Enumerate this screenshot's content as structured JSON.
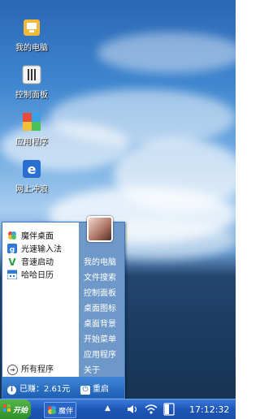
{
  "desktop": {
    "icons": [
      {
        "label": "我的电脑",
        "icon": "computer-icon"
      },
      {
        "label": "控制面板",
        "icon": "control-panel-icon"
      },
      {
        "label": "应用程序",
        "icon": "applications-icon"
      },
      {
        "label": "网上冲浪",
        "icon": "ie-browser-icon"
      }
    ]
  },
  "start_menu": {
    "apps": [
      {
        "label": "魔伴桌面",
        "icon": "mobo-desktop-icon"
      },
      {
        "label": "光速输入法",
        "icon": "input-method-icon"
      },
      {
        "label": "音速启动",
        "icon": "quick-launch-icon"
      },
      {
        "label": "哈哈日历",
        "icon": "calendar-icon"
      }
    ],
    "all_programs": "所有程序",
    "system_items": [
      "我的电脑",
      "文件搜索",
      "控制面板",
      "桌面图标",
      "桌面背景",
      "开始菜单",
      "应用程序",
      "关于"
    ],
    "earned": "已赚：2.61元",
    "restart": "重启"
  },
  "taskbar": {
    "start_label": "开始",
    "task_label": "魔伴",
    "tray_arrow": "▲",
    "clock": "17:12:32"
  },
  "colors": {
    "taskbar": "#1f56b8",
    "start_button": "#2f8f2a",
    "menu_right": "#6e98c8"
  }
}
